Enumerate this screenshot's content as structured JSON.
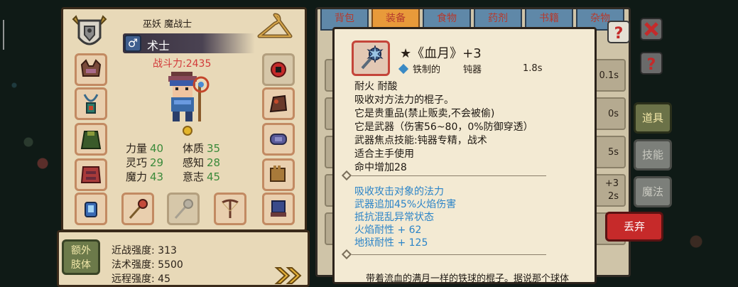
{
  "character": {
    "race_name": "巫妖 魔战士",
    "class_name": "术士",
    "gender_symbol": "♂",
    "combat_power": "战斗力:2435",
    "stats": [
      [
        {
          "name": "力量",
          "value": "40"
        },
        {
          "name": "体质",
          "value": "35"
        }
      ],
      [
        {
          "name": "灵巧",
          "value": "29"
        },
        {
          "name": "感知",
          "value": "28"
        }
      ],
      [
        {
          "name": "魔力",
          "value": "43"
        },
        {
          "name": "意志",
          "value": "45"
        }
      ]
    ]
  },
  "strength_panel": {
    "extra_limb_label_1": "额外",
    "extra_limb_label_2": "肢体",
    "lines": [
      "近战强度: 313",
      "法术强度: 5500",
      "远程强度: 45"
    ]
  },
  "inventory": {
    "tabs": [
      "背包",
      "装备",
      "食物",
      "药剂",
      "书籍",
      "杂物"
    ],
    "active_tab": "装备",
    "right_values": [
      "0.1s",
      "0s",
      "5s",
      "+3",
      "2s"
    ],
    "side_buttons": [
      {
        "label": "道具",
        "state": "active"
      },
      {
        "label": "技能",
        "state": "inactive"
      },
      {
        "label": "魔法",
        "state": "inactive"
      }
    ],
    "discard_label": "丢弃"
  },
  "tooltip": {
    "title": "★《血月》+3",
    "material": "铁制的",
    "weapon_type": "钝器",
    "speed": "1.8s",
    "description": [
      "耐火  耐酸",
      "吸收对方法力的棍子。",
      "它是贵重品(禁止贩卖,不会被偷)",
      "它是武器（伤害56~80，0%防御穿透）",
      "武器焦点技能:钝器专精，战术",
      "适合主手使用",
      "命中增加28"
    ],
    "effects": [
      "吸收攻击对象的法力",
      "武器追加45%火焰伤害",
      "抵抗混乱异常状态",
      "火焰耐性 + 62",
      "地狱耐性 + 125"
    ],
    "flavor": "带着流血的满月一样的铁球的棍子。据说那个球体"
  },
  "colors": {
    "panel_bg": "#e8d9b8",
    "stat_value": "#3a8a3a",
    "combat_power": "#d23a3a",
    "effect_text": "#2b84c8",
    "discard_btn": "#c62a2a",
    "active_tab": "#e89a3a",
    "inactive_tab": "#5f88a8"
  }
}
